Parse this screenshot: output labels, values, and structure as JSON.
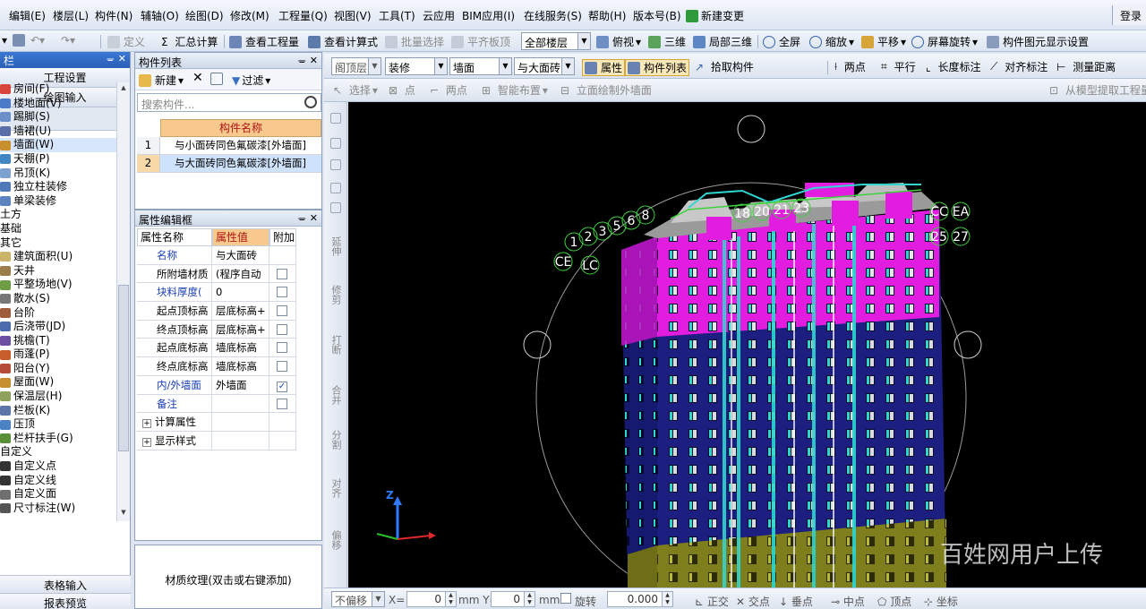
{
  "menu": [
    "编辑(E)",
    "楼层(L)",
    "构件(N)",
    "辅轴(O)",
    "绘图(D)",
    "修改(M)",
    "工程量(Q)",
    "视图(V)",
    "工具(T)",
    "云应用",
    "BIM应用(I)",
    "在线服务(S)",
    "帮助(H)",
    "版本号(B)",
    "新建变更"
  ],
  "login_label": "登录",
  "toolbar1": {
    "define": "定义",
    "sum_calc": "汇总计算",
    "view_quantity": "查看工程量",
    "view_formula": "查看计算式",
    "batch_select": "批量选择",
    "flat_slab": "平齐板顶",
    "floor_select": "全部楼层",
    "top_view": "俯视",
    "three_d": "三维",
    "local_3d": "局部三维",
    "fullscreen": "全屏",
    "zoom": "缩放",
    "pan": "平移",
    "rotate_screen": "屏幕旋转",
    "display_settings": "构件图元显示设置"
  },
  "leftnav": {
    "header": "栏",
    "btn_project_settings": "工程设置",
    "btn_drawing_input": "绘图输入",
    "tree": [
      {
        "label": "房间(F)",
        "color": "#d8443a"
      },
      {
        "label": "楼地面(V)",
        "color": "#4a7ac8"
      },
      {
        "label": "踢脚(S)",
        "color": "#6b8fc9"
      },
      {
        "label": "墙裙(U)",
        "color": "#5a6fa8"
      },
      {
        "label": "墙面(W)",
        "color": "#c88f2e",
        "selected": true
      },
      {
        "label": "天棚(P)",
        "color": "#3f86c2"
      },
      {
        "label": "吊顶(K)",
        "color": "#7ca0d0"
      },
      {
        "label": "独立柱装修",
        "color": "#4f79b9"
      },
      {
        "label": "单梁装修",
        "color": "#5a83bf"
      },
      {
        "label": "土方",
        "group": true
      },
      {
        "label": "基础",
        "group": true
      },
      {
        "label": "其它",
        "group": true
      },
      {
        "label": "建筑面积(U)",
        "color": "#c9b46a"
      },
      {
        "label": "天井",
        "color": "#9b7d4a"
      },
      {
        "label": "平整场地(V)",
        "color": "#6f9d45"
      },
      {
        "label": "散水(S)",
        "color": "#777"
      },
      {
        "label": "台阶",
        "color": "#a05c3b"
      },
      {
        "label": "后浇带(JD)",
        "color": "#4d6cae"
      },
      {
        "label": "挑檐(T)",
        "color": "#6b4fa0"
      },
      {
        "label": "雨蓬(P)",
        "color": "#c75d2b"
      },
      {
        "label": "阳台(Y)",
        "color": "#b54c3a"
      },
      {
        "label": "屋面(W)",
        "color": "#c88f2e"
      },
      {
        "label": "保温层(H)",
        "color": "#8fa15a"
      },
      {
        "label": "栏板(K)",
        "color": "#5c76aa"
      },
      {
        "label": "压顶",
        "color": "#4a82c4"
      },
      {
        "label": "栏杆扶手(G)",
        "color": "#5a8f3a"
      },
      {
        "label": "自定义",
        "group": true
      },
      {
        "label": "自定义点",
        "color": "#333"
      },
      {
        "label": "自定义线",
        "color": "#333"
      },
      {
        "label": "自定义面",
        "color": "#6f6f6f"
      },
      {
        "label": "尺寸标注(W)",
        "color": "#555"
      }
    ],
    "btn_table_input": "表格输入",
    "btn_report_preview": "报表预览"
  },
  "component_list": {
    "title": "构件列表",
    "new_label": "新建",
    "filter_label": "过滤",
    "search_placeholder": "搜索构件...",
    "column_header": "构件名称",
    "rows": [
      {
        "index": "1",
        "name": "与小面砖同色氟碳漆[外墙面]"
      },
      {
        "index": "2",
        "name": "与大面砖同色氟碳漆[外墙面]",
        "selected": true
      }
    ]
  },
  "property_editor": {
    "title": "属性编辑框",
    "headers": [
      "属性名称",
      "属性值",
      "附加"
    ],
    "rows": [
      {
        "name": "名称",
        "value": "与大面砖",
        "blue": true,
        "check": null
      },
      {
        "name": "所附墙材质",
        "value": "(程序自动",
        "blue": false,
        "check": false
      },
      {
        "name": "块料厚度(",
        "value": "0",
        "blue": true,
        "check": false
      },
      {
        "name": "起点顶标高",
        "value": "层底标高+",
        "blue": false,
        "check": false
      },
      {
        "name": "终点顶标高",
        "value": "层底标高+",
        "blue": false,
        "check": false
      },
      {
        "name": "起点底标高",
        "value": "墙底标高",
        "blue": false,
        "check": false
      },
      {
        "name": "终点底标高",
        "value": "墙底标高",
        "blue": false,
        "check": false
      },
      {
        "name": "内/外墙面",
        "value": "外墙面",
        "blue": true,
        "check": true
      },
      {
        "name": "备注",
        "value": "",
        "blue": true,
        "check": false
      },
      {
        "name": "计算属性",
        "value": "",
        "blue": false,
        "expand": true
      },
      {
        "name": "显示样式",
        "value": "",
        "blue": false,
        "expand": true
      }
    ]
  },
  "texture_hint": "材质纹理(双击或右键添加)",
  "toolbar2": {
    "floor": "阁顶层",
    "category": "装修",
    "type": "墙面",
    "component": "与大面砖",
    "property": "属性",
    "component_list": "构件列表",
    "pick": "拾取构件",
    "two_points": "两点",
    "parallel": "平行",
    "length_mark": "长度标注",
    "align_mark": "对齐标注",
    "measure": "测量距离"
  },
  "toolbar3": {
    "select": "选择",
    "point": "点",
    "two_points": "两点",
    "smart_layout": "智能布置",
    "elevation_draw": "立面绘制外墙面",
    "extract": "从模型提取工程量"
  },
  "vertical_tools": [
    "延伸",
    "修剪",
    "打断",
    "合并",
    "分割",
    "对齐",
    "偏移"
  ],
  "canvas_labels": {
    "axis_z": "Z",
    "grid_left": [
      "1",
      "2",
      "3",
      "5",
      "6",
      "8"
    ],
    "grid_top": [
      "18",
      "20",
      "21",
      "23"
    ],
    "grid_right": [
      "CC",
      "EA",
      "25",
      "27"
    ],
    "grid_misc": [
      "CE",
      "LC"
    ]
  },
  "watermark": "百姓网用户上传",
  "statusbar": {
    "offset": "不偏移",
    "x_label": "X=",
    "x_value": "0",
    "y_label": "mm Y=",
    "y_value": "0",
    "unit": "mm",
    "rotate": "旋转",
    "rotate_value": "0.000",
    "ortho": "正交",
    "intersection": "交点",
    "perpendicular": "垂点",
    "midpoint": "中点",
    "vertex": "顶点",
    "coord": "坐标"
  },
  "colors": {
    "panel_header": "#2b5fb6",
    "magenta": "#e31de0",
    "navy": "#1a1f7a",
    "cyan": "#2fd6d0",
    "olive": "#8a8a1e"
  }
}
